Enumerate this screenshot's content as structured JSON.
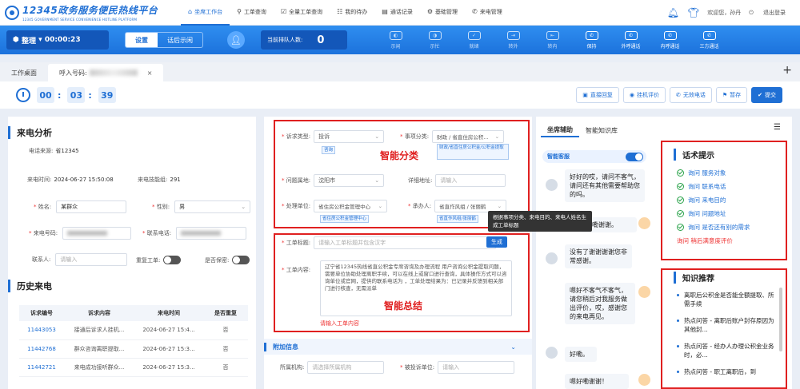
{
  "app": {
    "title": "12345政务服务便民热线平台",
    "subtitle": "12345 GOVERNMENT SERVICE CONVENIENCE HOTLINE PLATFORM"
  },
  "nav": [
    {
      "label": "坐席工作台",
      "icon": "⌂"
    },
    {
      "label": "工单查询",
      "icon": "⚲"
    },
    {
      "label": "全量工单查询",
      "icon": "☑"
    },
    {
      "label": "我的待办",
      "icon": "☷"
    },
    {
      "label": "通话记录",
      "icon": "▤"
    },
    {
      "label": "基础管理",
      "icon": "⚙"
    },
    {
      "label": "来电管理",
      "icon": "✆"
    }
  ],
  "user": {
    "welcome": "欢迎您，孙丹",
    "logout": "退出登录"
  },
  "toolbar": {
    "state": "整理",
    "timer": "00:00:23",
    "seg_settings": "设置",
    "seg_after": "话后示闲",
    "queue_label": "当前排队人数:",
    "queue_count": "0",
    "tools": [
      "示闲",
      "示忙",
      "就绪",
      "转外",
      "转内",
      "保持",
      "外呼通话",
      "内呼通话",
      "三方通话"
    ]
  },
  "tabs": {
    "desk": "工作桌面",
    "call": "呼入号码:",
    "close": "×",
    "add": "+"
  },
  "call_timer": {
    "h": "00",
    "m": "03",
    "s": "39"
  },
  "actions": [
    "直接回复",
    "挂机评价",
    "无效电话",
    "暂存",
    "提交"
  ],
  "left": {
    "title": "来电分析",
    "source_label": "电话来源:",
    "source_value": "省12345",
    "time_label": "来电时间:",
    "time_value": "2024-06-27 15:50:08",
    "skill_label": "来电技能组:",
    "skill_value": "291",
    "name_label": "姓名:",
    "name_value": "某群众",
    "gender_label": "性别:",
    "gender_value": "男",
    "phone_label": "来电号码:",
    "contact_phone_label": "联系电话:",
    "contact_label": "联系人:",
    "contact_placeholder": "请输入",
    "dup_label": "重复工单:",
    "secret_label": "是否保密:",
    "history_title": "历史来电",
    "history_headers": [
      "诉求编号",
      "诉求内容",
      "来电时间",
      "是否重复"
    ],
    "history_rows": [
      [
        "11443053",
        "接通后诉求人挂机...",
        "2024-06-27 15:4...",
        "否"
      ],
      [
        "11442768",
        "群众咨询离职提取...",
        "2024-06-27 15:3...",
        "否"
      ],
      [
        "11442721",
        "来电成功接听群众...",
        "2024-06-27 15:3...",
        "否"
      ]
    ]
  },
  "mid": {
    "type_label": "诉求类型:",
    "type_value": "投诉",
    "type_tag": "咨询",
    "cat_label": "事项分类:",
    "cat_value": "财政 / 省直住房公积...",
    "cat_tag": "财政/省直住房公积金/公积金提取",
    "area_label": "问题属地:",
    "area_value": "沈阳市",
    "addr_label": "详细地址:",
    "addr_placeholder": "请输入",
    "unit_label": "处理单位:",
    "unit_value": "省住房公积金管理中心",
    "unit_tag": "省住房公积金管理中心",
    "handler_label": "承办人:",
    "handler_value": "省直作风组 / 张丽鹤",
    "handler_tag": "省直作风组/张丽鹤",
    "ai_class": "智能分类",
    "tooltip": "根据事项分类、来电目的、来电人姓名生成工单标题",
    "title_label": "工单标题:",
    "title_placeholder": "请输入工单标题并包含汉字",
    "gen_btn": "生成",
    "content_label": "工单内容:",
    "content_text": "辽宁省12345热线省直公积金专席咨询及办理流程 用户咨询公积金提取问题，需要单位协助处理离职手续，可以在线上或窗口进行查询，具体操作方式可以咨询单位或官网，提供的联系电话为                    ，工单处理结果为：已记录并反馈到相关部门进行核查，无需派单",
    "ai_summary": "智能总结",
    "content_error": "请输入工单内容",
    "extra_title": "附加信息",
    "org_label": "所属机构:",
    "org_placeholder": "请选择所属机构",
    "complained_label": "被投诉单位:",
    "complained_placeholder": "请输入"
  },
  "right": {
    "tab_assist": "坐席辅助",
    "tab_kb": "智能知识库",
    "ai_label": "智能客服",
    "chat": [
      {
        "who": "cust",
        "text": "好好的哎，请问不客气，请问还有其他需要帮助您的吗。"
      },
      {
        "who": "agent",
        "text": "好嘞谢谢。"
      },
      {
        "who": "cust",
        "text": "没有了谢谢谢谢您非常感谢。"
      },
      {
        "who": "agent",
        "text": "嗯好不客气不客气，请您稍后对我服务做出评价，哎，感谢您的来电再见。"
      },
      {
        "who": "cust",
        "text": "好嘞。"
      },
      {
        "who": "agent",
        "text": "嗯好嘞谢谢！"
      }
    ],
    "tips_title": "话术提示",
    "tips": [
      "询问 服务对象",
      "询问 联系电话",
      "询问 来电目的",
      "询问 问题地址",
      "询问 是否还有别的需求"
    ],
    "tips_last": "询问 稍后满意度评价",
    "kb_title": "知识推荐",
    "kb": [
      "离职后公积金是否能全额提取、所需手续",
      "热点问答 - 离职后账户封存原因为其他封...",
      "热点问答 - 经办人办理公积金业务时，必...",
      "热点问答 - 职工离职后，到"
    ]
  }
}
